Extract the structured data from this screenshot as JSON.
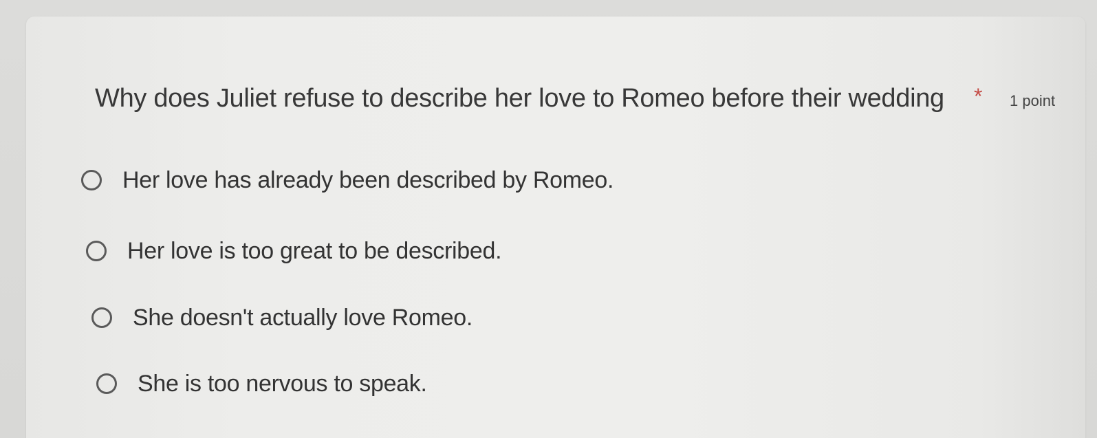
{
  "question": {
    "title": "Why does Juliet refuse to describe her love to Romeo before their wedding",
    "required_mark": "*",
    "points": "1 point"
  },
  "options": [
    {
      "label": "Her love has already been described by Romeo.",
      "selected": false
    },
    {
      "label": "Her love is too great to be described.",
      "selected": false
    },
    {
      "label": "She doesn't actually love Romeo.",
      "selected": false
    },
    {
      "label": "She is too nervous to speak.",
      "selected": false
    }
  ],
  "colors": {
    "required": "#c44a44",
    "text": "#333333",
    "radio_border": "#5a5a5a"
  }
}
